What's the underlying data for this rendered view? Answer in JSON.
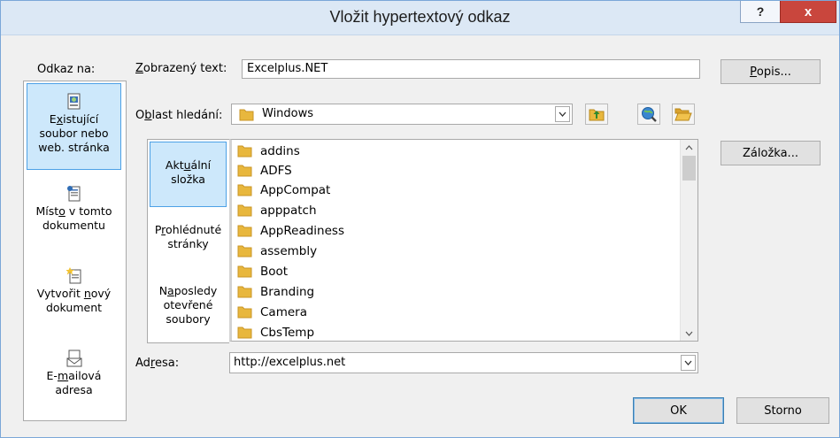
{
  "window": {
    "title": "Vložit hypertextový odkaz",
    "help": "?",
    "close": "x"
  },
  "nav": {
    "label": "Odkaz na:",
    "items": [
      {
        "line1_pre": "E",
        "line1_u": "x",
        "line1_post": "istující",
        "line2": "soubor nebo",
        "line3": "web. stránka",
        "icon": "existing-file-icon"
      },
      {
        "line1_pre": "Míst",
        "line1_u": "o",
        "line1_post": " v tomto",
        "line2": "dokumentu",
        "icon": "place-in-document-icon"
      },
      {
        "line1_pre": "Vytvořit ",
        "line1_u": "n",
        "line1_post": "ový",
        "line2": "dokument",
        "icon": "new-document-icon"
      },
      {
        "line1_pre": "E-",
        "line1_u": "m",
        "line1_post": "ailová",
        "line2": "adresa",
        "icon": "email-icon"
      }
    ]
  },
  "display_text": {
    "label_u": "Z",
    "label_rest": "obrazený text:",
    "value": "Excelplus.NET"
  },
  "buttons": {
    "popis_u": "P",
    "popis_rest": "opis...",
    "zalozka": "Záložka...",
    "ok": "OK",
    "storno": "Storno"
  },
  "look_in": {
    "label_pre": "O",
    "label_u": "b",
    "label_post": "last hledání:",
    "value": "Windows"
  },
  "tabs": [
    {
      "line1_pre": "Akt",
      "line1_u": "u",
      "line1_post": "ální",
      "line2": "složka"
    },
    {
      "line1_pre": "P",
      "line1_u": "r",
      "line1_post": "ohlédnuté",
      "line2": "stránky"
    },
    {
      "line1_pre": "N",
      "line1_u": "a",
      "line1_post": "posledy",
      "line2": "otevřené",
      "line3": "soubory"
    }
  ],
  "files": [
    "addins",
    "ADFS",
    "AppCompat",
    "apppatch",
    "AppReadiness",
    "assembly",
    "Boot",
    "Branding",
    "Camera",
    "CbsTemp"
  ],
  "address": {
    "label_pre": "Ad",
    "label_u": "r",
    "label_post": "esa:",
    "value": "http://excelplus.net"
  }
}
